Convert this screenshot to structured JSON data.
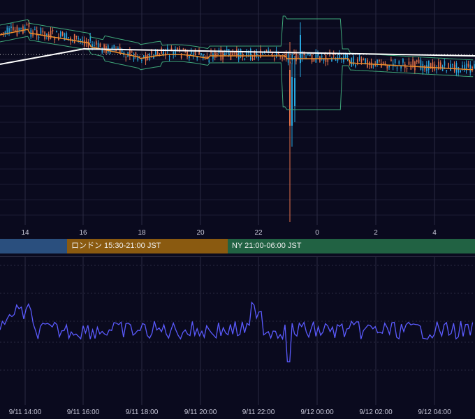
{
  "hour_axis": {
    "labels": [
      "14",
      "16",
      "18",
      "20",
      "22",
      "0",
      "2",
      "4"
    ]
  },
  "sessions": {
    "london": "ロンドン 15:30-21:00 JST",
    "ny": "NY 21:00-06:00 JST"
  },
  "date_axis": {
    "labels": [
      "9/11 14:00",
      "9/11 16:00",
      "9/11 18:00",
      "9/11 20:00",
      "9/11 22:00",
      "9/12 00:00",
      "9/12 02:00",
      "9/12 04:00"
    ]
  },
  "colors": {
    "background": "#0a0a1e",
    "candle_up": "#29a8e0",
    "candle_down": "#e8734a",
    "moving_average": "#f0902a",
    "bollinger_band": "#3fa87a",
    "trend_line": "#ffffff",
    "oscillator": "#5b5bff",
    "session_tokyo": "#2a4f7e",
    "session_london": "#8a5a10",
    "session_ny": "#216243"
  }
}
